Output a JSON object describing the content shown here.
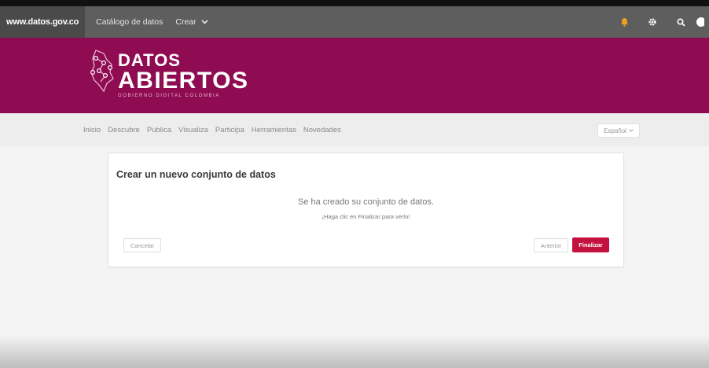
{
  "topbar": {
    "site": "www.datos.gov.co",
    "catalog": "Catálogo de datos",
    "crear": "Crear",
    "icons": [
      "bell-icon",
      "gear-icon",
      "search-icon",
      "user-icon"
    ]
  },
  "banner": {
    "logo_line1": "DATOS",
    "logo_line2": "ABIERTOS",
    "logo_line3": "GOBIERNO DIGITAL COLOMBIA",
    "bg": "#8f0c52"
  },
  "nav": {
    "items": [
      "Inicio",
      "Descubre",
      "Publica",
      "Visualiza",
      "Participa",
      "Herramientas",
      "Novedades"
    ],
    "language": "Español"
  },
  "card": {
    "title": "Crear un nuevo conjunto de datos",
    "message": "Se ha creado su conjunto de datos.",
    "submessage": "¡Haga clic en Finalizar para verlo!",
    "cancel": "Cancelar",
    "previous": "Anterior",
    "finish": "Finalizar",
    "finish_color": "#c4113f"
  }
}
